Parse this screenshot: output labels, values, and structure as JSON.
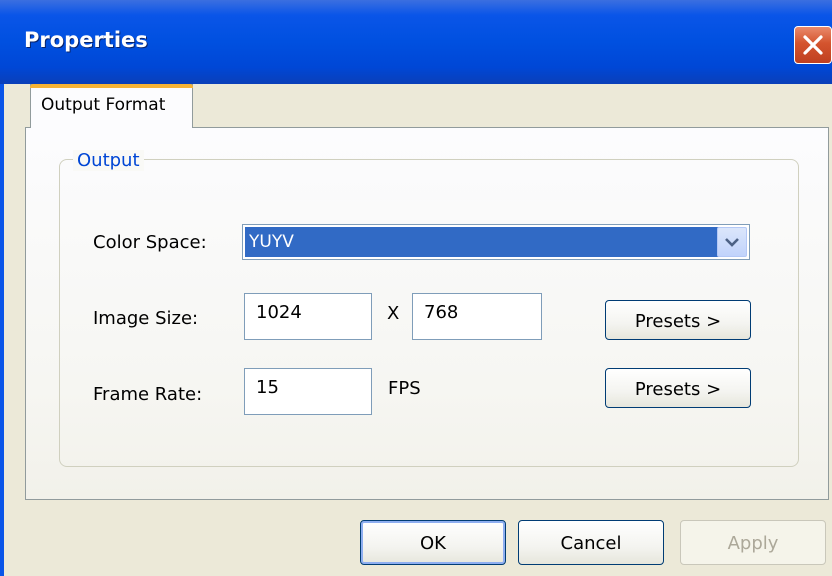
{
  "window": {
    "title": "Properties",
    "close_icon": "close-x-icon"
  },
  "tabs": [
    {
      "label": "Output Format",
      "selected": true
    }
  ],
  "group": {
    "title": "Output",
    "color_space": {
      "label": "Color Space:",
      "value": "YUYV",
      "arrow_icon": "chevron-down-icon"
    },
    "image_size": {
      "label": "Image Size:",
      "width": "1024",
      "separator": "X",
      "height": "768",
      "presets_label": "Presets >"
    },
    "frame_rate": {
      "label": "Frame Rate:",
      "value": "15",
      "unit": "FPS",
      "presets_label": "Presets >"
    }
  },
  "buttons": {
    "ok": "OK",
    "cancel": "Cancel",
    "apply": "Apply"
  },
  "colors": {
    "title_bar": "#0050e0",
    "selection": "#316ac5",
    "group_title": "#0046d5",
    "tab_accent": "#f7b334",
    "close_button": "#d4542e"
  }
}
